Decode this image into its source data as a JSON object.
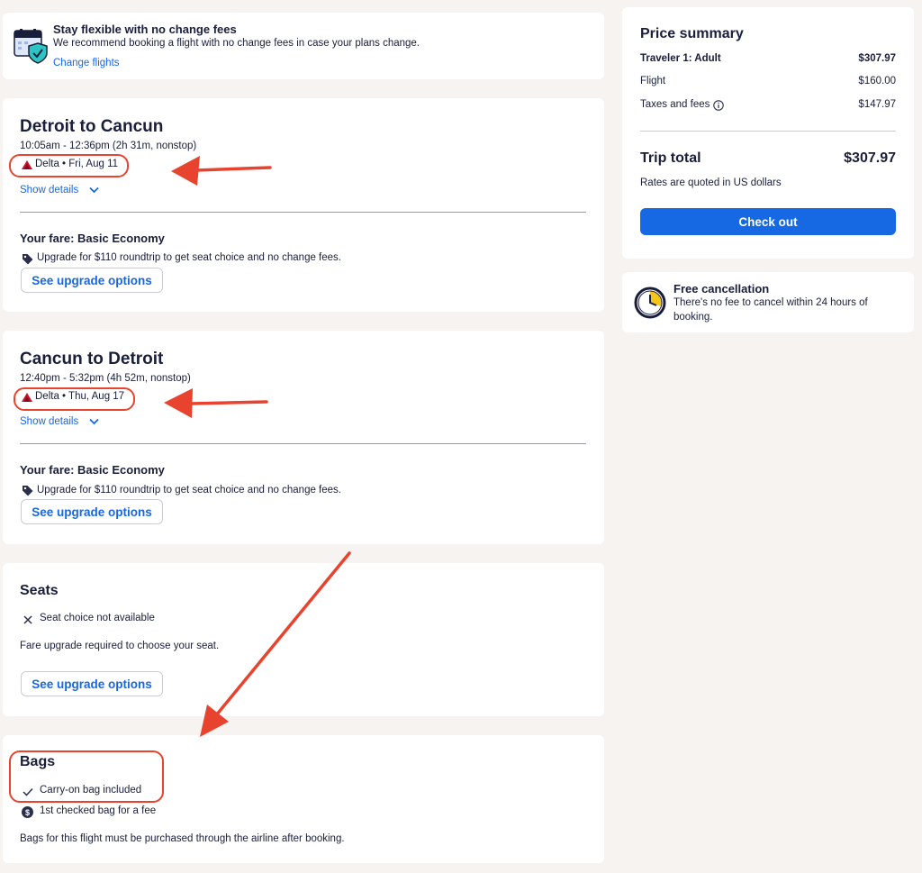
{
  "flex_banner": {
    "title": "Stay flexible with no change fees",
    "body": "We recommend booking a flight with no change fees in case your plans change.",
    "link": "Change flights"
  },
  "outbound": {
    "route": "Detroit to Cancun",
    "times": "10:05am - 12:36pm (2h 31m, nonstop)",
    "airline_date": "Delta • Fri, Aug 11",
    "details_link": "Show details",
    "fare_label": "Your fare: Basic Economy",
    "upgrade_text": "Upgrade for $110 roundtrip to get seat choice and no change fees.",
    "upgrade_button": "See upgrade options"
  },
  "return": {
    "route": "Cancun to Detroit",
    "times": "12:40pm - 5:32pm (4h 52m, nonstop)",
    "airline_date": "Delta • Thu, Aug 17",
    "details_link": "Show details",
    "fare_label": "Your fare: Basic Economy",
    "upgrade_text": "Upgrade for $110 roundtrip to get seat choice and no change fees.",
    "upgrade_button": "See upgrade options"
  },
  "seats": {
    "title": "Seats",
    "status": "Seat choice not available",
    "note": "Fare upgrade required to choose your seat.",
    "upgrade_button": "See upgrade options"
  },
  "bags": {
    "title": "Bags",
    "carry_on": "Carry-on bag included",
    "checked": "1st checked bag for a fee",
    "note": "Bags for this flight must be purchased through the airline after booking."
  },
  "price_summary": {
    "title": "Price summary",
    "traveler_label": "Traveler 1: Adult",
    "traveler_value": "$307.97",
    "flight_label": "Flight",
    "flight_value": "$160.00",
    "taxes_label": "Taxes and fees",
    "taxes_value": "$147.97",
    "total_label": "Trip total",
    "total_value": "$307.97",
    "currency_note": "Rates are quoted in US dollars",
    "checkout_button": "Check out"
  },
  "free_cancel": {
    "title": "Free cancellation",
    "line1": "There's no fee to cancel within 24 hours of",
    "line2": "booking."
  },
  "colors": {
    "primary": "#1668e3",
    "annotation_red": "#e8432e",
    "text": "#191e3b",
    "delta_red": "#c8102e",
    "page_bg": "#f6f3f1"
  },
  "icons": [
    "calendar-shield-icon",
    "delta-logo-icon",
    "chevron-down-icon",
    "tag-icon",
    "close-icon",
    "check-icon",
    "dollar-circle-icon",
    "info-icon",
    "clock-icon"
  ]
}
